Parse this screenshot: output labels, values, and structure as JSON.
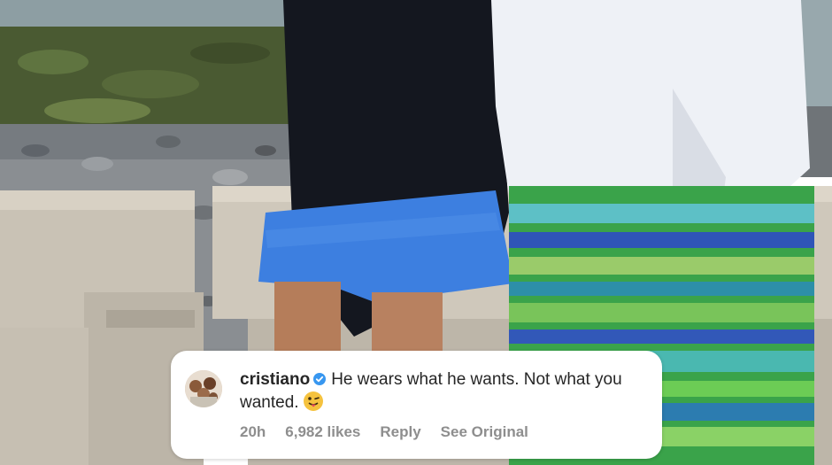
{
  "comment": {
    "username": "cristiano",
    "text": "He wears what he wants. Not what you wanted.",
    "emoji": "😜",
    "time": "20h",
    "likes": "6,982 likes",
    "reply_label": "Reply",
    "see_original_label": "See Original"
  },
  "icons": {
    "verified": "verified-badge-icon",
    "avatar": "avatar-icon"
  },
  "colors": {
    "verified_blue": "#3897f0",
    "meta_gray": "#8e8e8e",
    "text": "#262626"
  }
}
